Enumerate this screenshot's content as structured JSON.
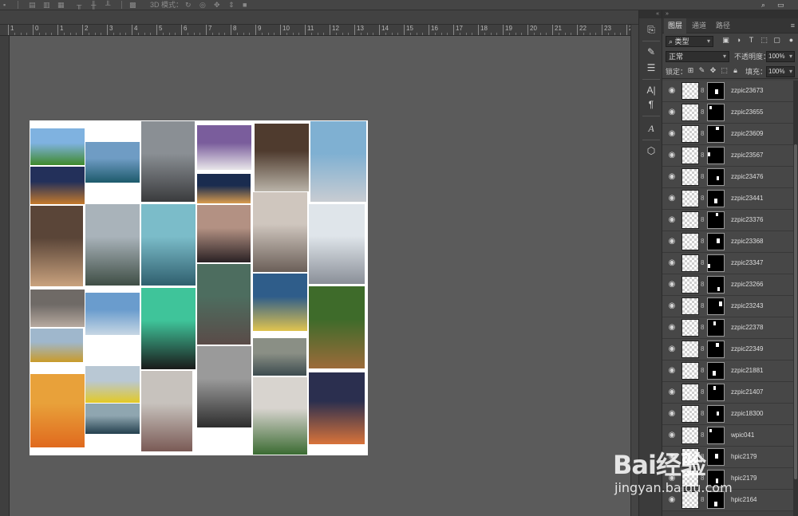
{
  "document": {
    "ruler_ticks": [
      "1",
      "0",
      "1",
      "2",
      "3",
      "4",
      "5",
      "6",
      "7",
      "8",
      "9",
      "10",
      "11",
      "12",
      "13",
      "14",
      "15",
      "16",
      "17",
      "18",
      "19",
      "20",
      "21",
      "22",
      "23",
      "24"
    ]
  },
  "options_bar": {
    "mode_label": "3D 模式："
  },
  "panel": {
    "tabs": [
      "图层",
      "通道",
      "路径"
    ],
    "filter_kind": "类型",
    "blend_mode": "正常",
    "opacity_label": "不透明度：",
    "opacity_value": "100%",
    "lock_label": "锁定：",
    "fill_label": "填充：",
    "fill_value": "100%"
  },
  "layers": [
    {
      "name": "zzpic23673",
      "mask_shape": [
        0.45,
        0.4,
        0.2,
        0.3
      ]
    },
    {
      "name": "zzpic23655",
      "mask_shape": [
        0.1,
        0.1,
        0.15,
        0.2
      ]
    },
    {
      "name": "zzpic23609",
      "mask_shape": [
        0.5,
        0.05,
        0.2,
        0.2
      ]
    },
    {
      "name": "zzpic23567",
      "mask_shape": [
        0.0,
        0.3,
        0.15,
        0.25
      ]
    },
    {
      "name": "zzpic23476",
      "mask_shape": [
        0.55,
        0.45,
        0.15,
        0.25
      ]
    },
    {
      "name": "zzpic23441",
      "mask_shape": [
        0.4,
        0.5,
        0.2,
        0.3
      ]
    },
    {
      "name": "zzpic23376",
      "mask_shape": [
        0.5,
        0.05,
        0.15,
        0.2
      ]
    },
    {
      "name": "zzpic23368",
      "mask_shape": [
        0.55,
        0.3,
        0.2,
        0.3
      ]
    },
    {
      "name": "zzpic23347",
      "mask_shape": [
        0.0,
        0.55,
        0.15,
        0.25
      ]
    },
    {
      "name": "zzpic23266",
      "mask_shape": [
        0.6,
        0.65,
        0.15,
        0.25
      ]
    },
    {
      "name": "zzpic23243",
      "mask_shape": [
        0.7,
        0.2,
        0.18,
        0.3
      ]
    },
    {
      "name": "zzpic22378",
      "mask_shape": [
        0.35,
        0.1,
        0.15,
        0.25
      ]
    },
    {
      "name": "zzpic22349",
      "mask_shape": [
        0.5,
        0.1,
        0.2,
        0.25
      ]
    },
    {
      "name": "zzpic21881",
      "mask_shape": [
        0.3,
        0.5,
        0.2,
        0.3
      ]
    },
    {
      "name": "zzpic21407",
      "mask_shape": [
        0.35,
        0.1,
        0.15,
        0.25
      ]
    },
    {
      "name": "zzpic18300",
      "mask_shape": [
        0.55,
        0.35,
        0.15,
        0.25
      ]
    },
    {
      "name": "wpic041",
      "mask_shape": [
        0.1,
        0.1,
        0.15,
        0.2
      ]
    },
    {
      "name": "hpic2179",
      "mask_shape": [
        0.45,
        0.3,
        0.2,
        0.3
      ]
    },
    {
      "name": "hpic2179",
      "mask_shape": [
        0.5,
        0.5,
        0.15,
        0.3
      ]
    },
    {
      "name": "hpic2164",
      "mask_shape": [
        0.4,
        0.6,
        0.2,
        0.3
      ]
    }
  ],
  "watermark": {
    "brand": "Bai经验",
    "url": "jingyan.baidu.com"
  },
  "photos": [
    {
      "id": "grass-field",
      "colors": [
        "#7fb2e0",
        "#3f8a2b"
      ]
    },
    {
      "id": "cliff-sea",
      "colors": [
        "#6f9cc4",
        "#1d5a6b"
      ]
    },
    {
      "id": "road-woman",
      "colors": [
        "#8a8f94",
        "#3a3b3d"
      ]
    },
    {
      "id": "woman-white",
      "colors": [
        "#7a5d9c",
        "#e9e6ea"
      ]
    },
    {
      "id": "mirror-forest",
      "colors": [
        "#4f3b2e",
        "#b9b3a8"
      ]
    },
    {
      "id": "white-church",
      "colors": [
        "#7fb0d2",
        "#c8ccd2"
      ]
    },
    {
      "id": "night-street",
      "colors": [
        "#23305a",
        "#c47a2d"
      ]
    },
    {
      "id": "night-houses",
      "colors": [
        "#1a2c4f",
        "#d99b4e"
      ]
    },
    {
      "id": "market-woman",
      "colors": [
        "#5a4538",
        "#c9a27e"
      ]
    },
    {
      "id": "coast-cliffs",
      "colors": [
        "#a9b3ba",
        "#3f4e45"
      ]
    },
    {
      "id": "glass-building",
      "colors": [
        "#7bbcc9",
        "#2f5f6e"
      ]
    },
    {
      "id": "hat-woman",
      "colors": [
        "#b39183",
        "#2a2124"
      ]
    },
    {
      "id": "wedding",
      "colors": [
        "#cfc6be",
        "#6b5f58"
      ]
    },
    {
      "id": "snow-blanket",
      "colors": [
        "#dfe5ea",
        "#8a8f98"
      ]
    },
    {
      "id": "red-road",
      "colors": [
        "#4d6d5f",
        "#5a4b48"
      ]
    },
    {
      "id": "yellow-shirt",
      "colors": [
        "#2f5d8a",
        "#e0c44f"
      ]
    },
    {
      "id": "old-houses",
      "colors": [
        "#8a8f85",
        "#3c4b4f"
      ]
    },
    {
      "id": "forest-path",
      "colors": [
        "#3e6b2a",
        "#9c6b3a"
      ]
    },
    {
      "id": "girl-street",
      "colors": [
        "#6f6a66",
        "#b7aaa0"
      ]
    },
    {
      "id": "lake-town",
      "colors": [
        "#6a9ccd",
        "#c7d7e4"
      ]
    },
    {
      "id": "green-woman",
      "colors": [
        "#3fc49a",
        "#1a1a1a"
      ]
    },
    {
      "id": "tram",
      "colors": [
        "#9fb7cc",
        "#c99b2a"
      ]
    },
    {
      "id": "vr-woman",
      "colors": [
        "#e8a13a",
        "#e06a1e"
      ]
    },
    {
      "id": "canola",
      "colors": [
        "#b9c8d4",
        "#e3c925"
      ]
    },
    {
      "id": "blue-car",
      "colors": [
        "#8fa6b0",
        "#24404e"
      ]
    },
    {
      "id": "couple",
      "colors": [
        "#c7c2bd",
        "#7a5a55"
      ]
    },
    {
      "id": "mountains-snow",
      "colors": [
        "#9a9a9a",
        "#2e2e2e"
      ]
    },
    {
      "id": "plant",
      "colors": [
        "#d8d4cf",
        "#3b6b32"
      ]
    },
    {
      "id": "airplane-sunset",
      "colors": [
        "#2b2f4f",
        "#d9733a"
      ]
    }
  ]
}
